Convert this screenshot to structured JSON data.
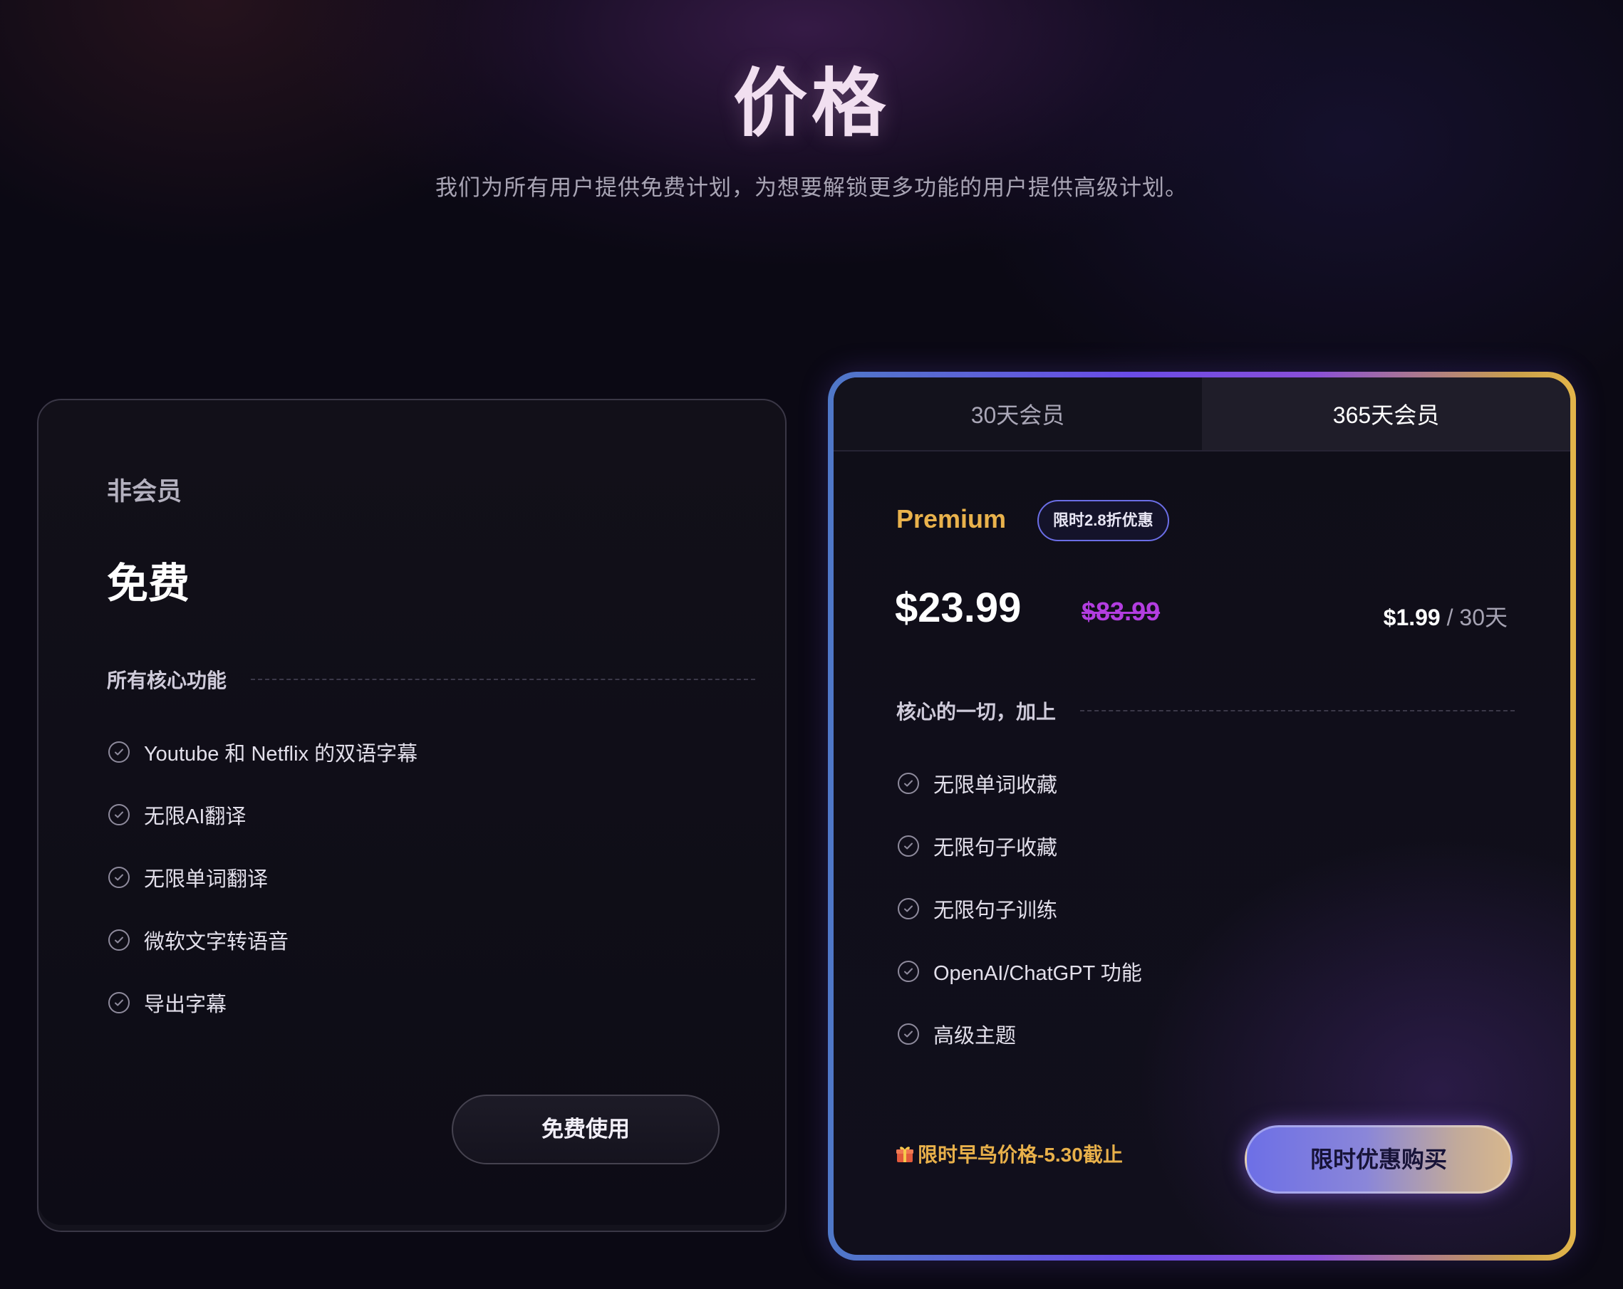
{
  "header": {
    "title": "价格",
    "subtitle": "我们为所有用户提供免费计划，为想要解锁更多功能的用户提供高级计划。"
  },
  "free_plan": {
    "label": "非会员",
    "price": "免费",
    "section_title": "所有核心功能",
    "features": [
      "Youtube 和 Netflix 的双语字幕",
      "无限AI翻译",
      "无限单词翻译",
      "微软文字转语音",
      "导出字幕"
    ],
    "button_label": "免费使用"
  },
  "premium_plan": {
    "tabs": [
      {
        "label": "30天会员",
        "active": false
      },
      {
        "label": "365天会员",
        "active": true
      }
    ],
    "name": "Premium",
    "promo_badge": "限时2.8折优惠",
    "price": "$23.99",
    "original_price": "$83.99",
    "per_period_amount": "$1.99",
    "per_period_unit": " / 30天",
    "section_title": "核心的一切，加上",
    "features": [
      "无限单词收藏",
      "无限句子收藏",
      "无限句子训练",
      "OpenAI/ChatGPT 功能",
      "高级主题"
    ],
    "early_bird_text": "限时早鸟价格-5.30截止",
    "early_bird_icon": "gift-icon",
    "button_label": "限时优惠购买"
  },
  "colors": {
    "premium_accent": "#e9b24c",
    "strike_price": "#b33de0",
    "badge_border": "#6b6ee6"
  }
}
